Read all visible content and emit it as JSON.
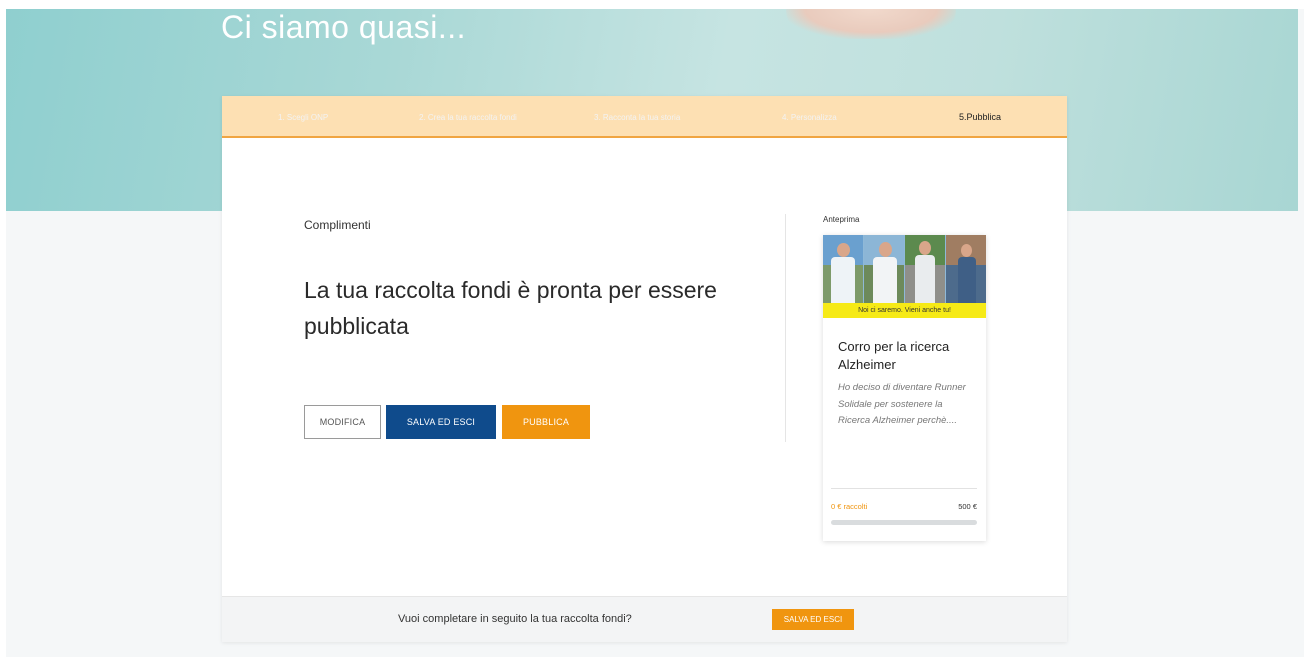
{
  "hero": {
    "title": "Ci siamo quasi..."
  },
  "steps": [
    {
      "label": "1. Scegli ONP"
    },
    {
      "label": "2. Crea la tua raccolta fondi"
    },
    {
      "label": "3. Racconta la tua storia"
    },
    {
      "label": "4. Personalizza"
    },
    {
      "label": "5.Pubblica"
    }
  ],
  "main": {
    "kicker": "Complimenti",
    "headline": "La tua raccolta fondi è pronta per essere pubblicata",
    "buttons": {
      "modifica": "MODIFICA",
      "salva": "SALVA ED ESCI",
      "pubblica": "PUBBLICA"
    }
  },
  "preview": {
    "label": "Anteprima",
    "banner": "Noi ci saremo. Vieni anche tu!",
    "title": "Corro per la ricerca Alzheimer",
    "description": "Ho deciso di diventare Runner Solidale per sostenere la Ricerca Alzheimer perchè....",
    "raised": "0 € raccolti",
    "goal": "500 €",
    "progress": 0
  },
  "footer": {
    "text": "Vuoi completare in seguito la tua raccolta fondi?",
    "button": "SALVA ED ESCI"
  },
  "colors": {
    "accent": "#f0950f",
    "primary": "#0f4b8c",
    "steps_bg": "#fde0b3",
    "banner": "#f6ea16"
  }
}
